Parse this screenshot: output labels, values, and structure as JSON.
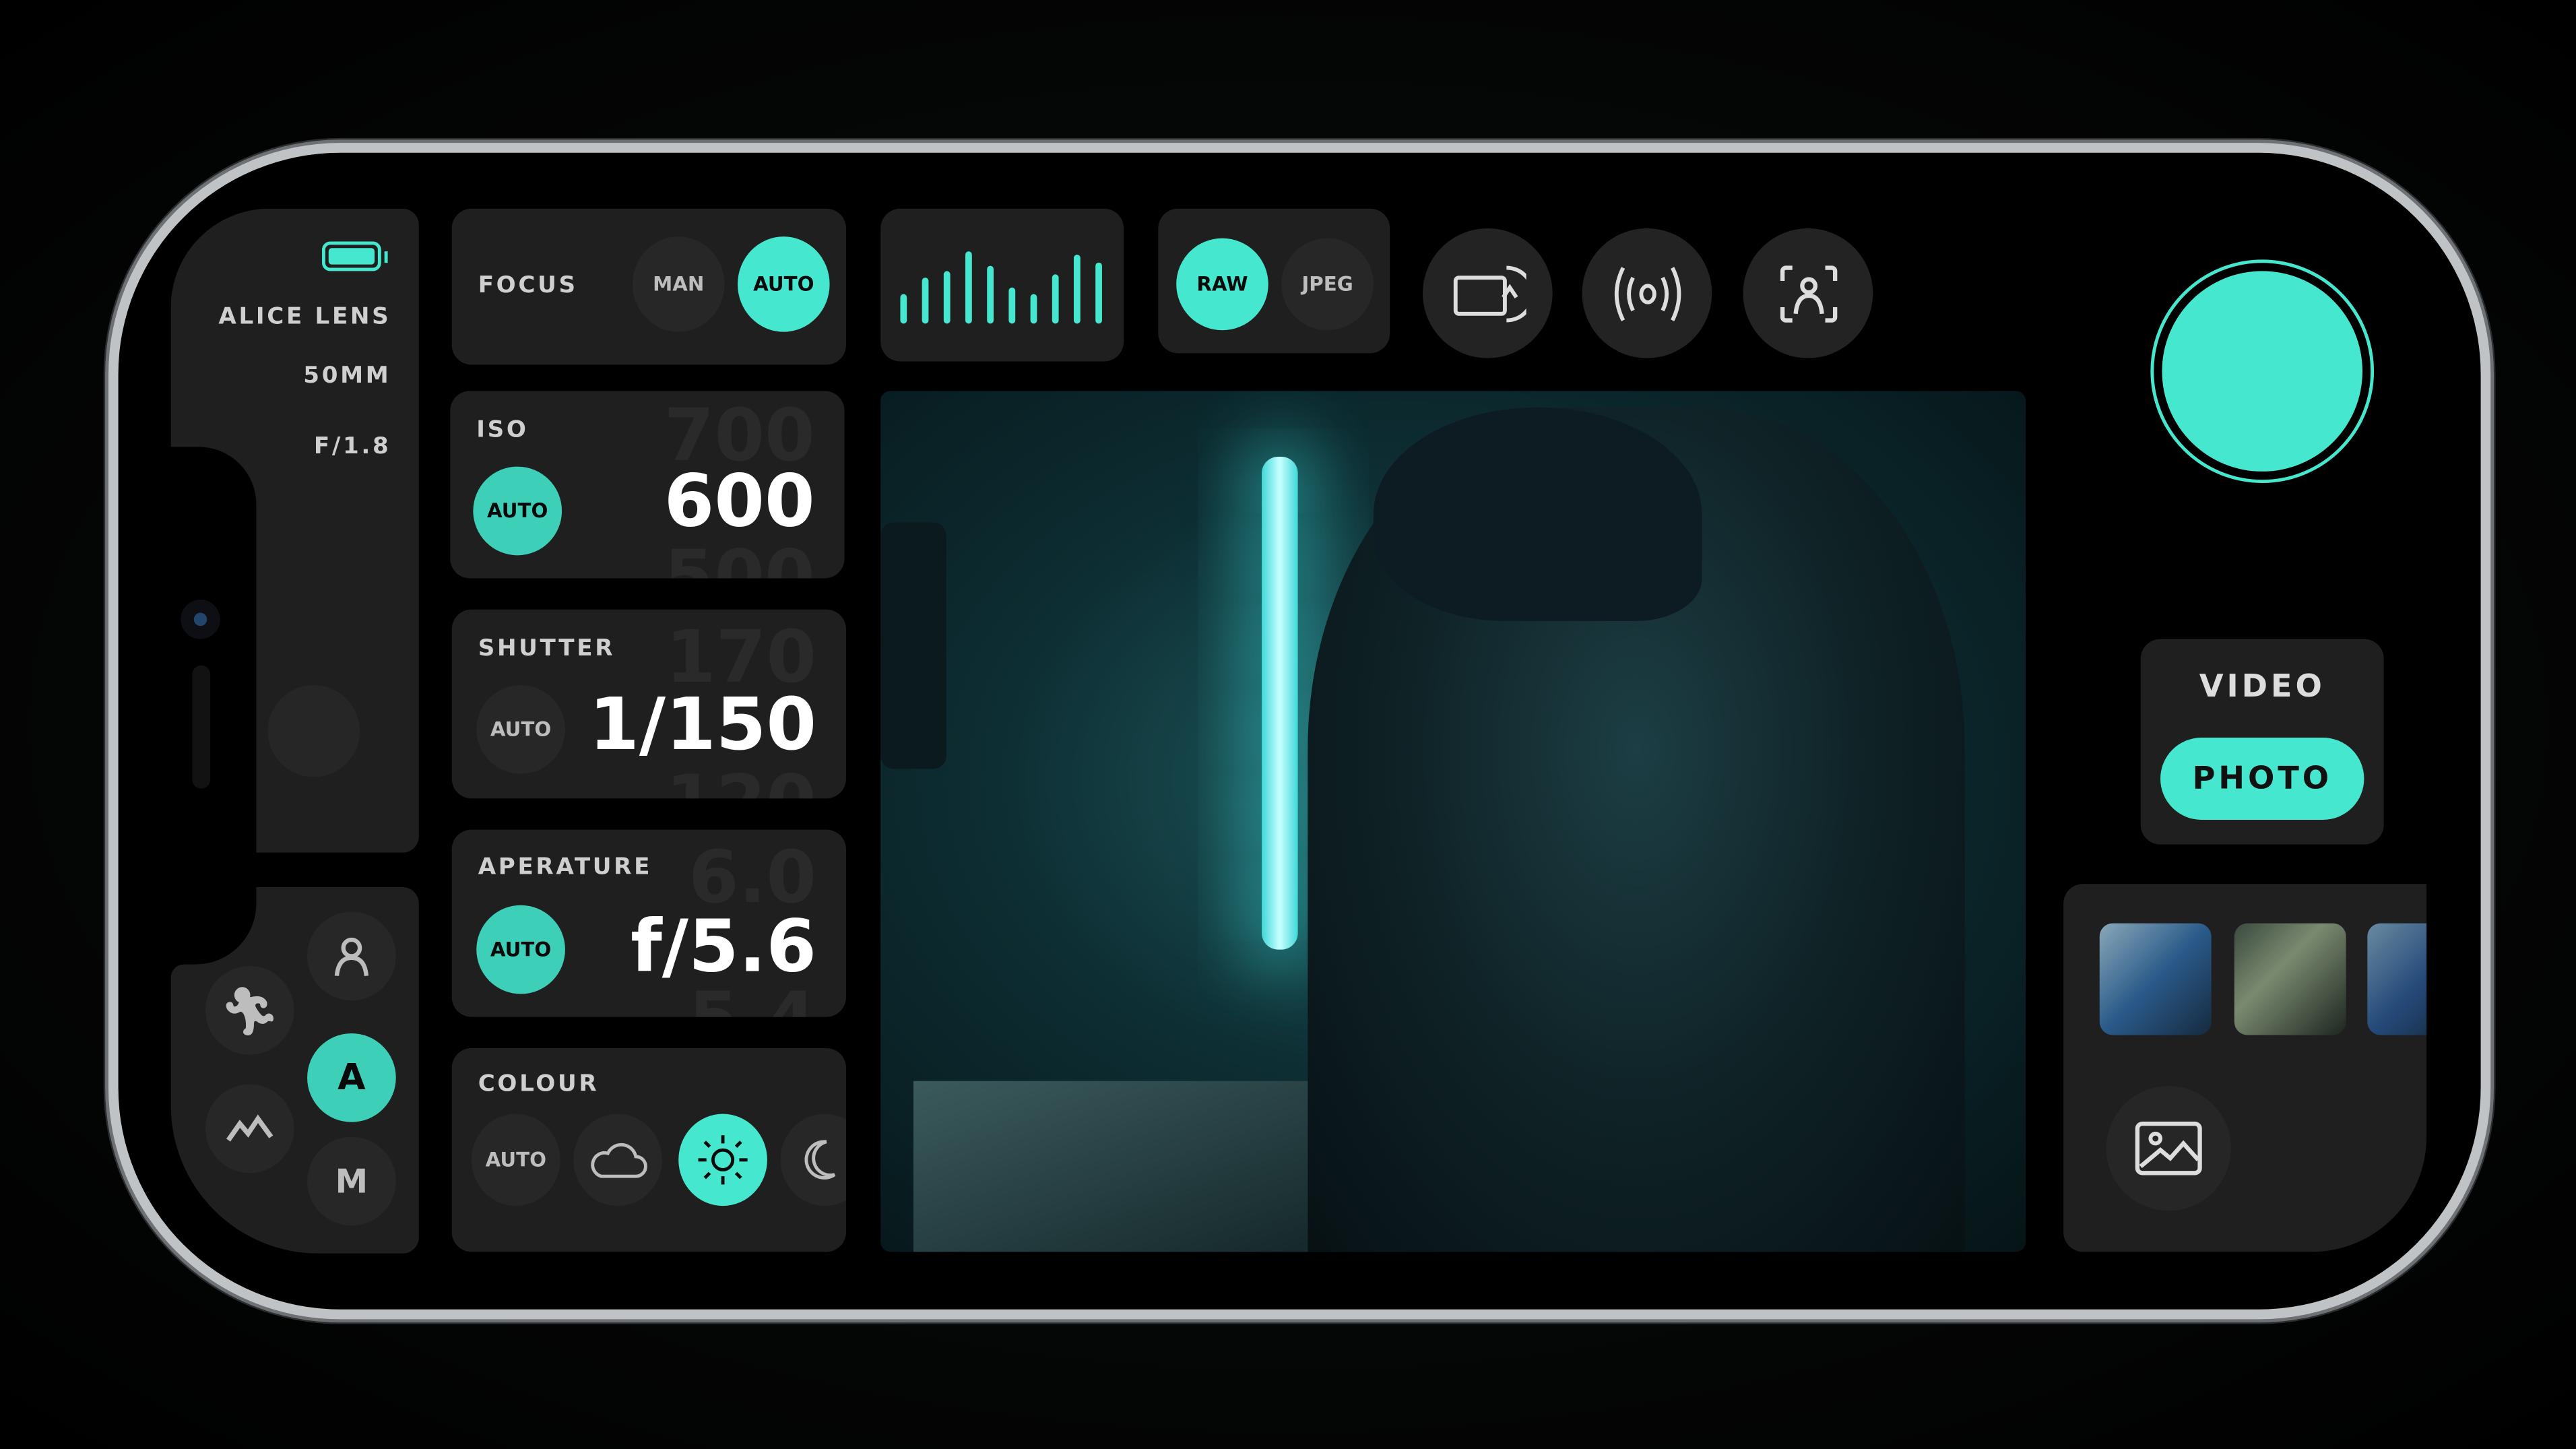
{
  "accent_color": "#45e8cf",
  "lens": {
    "battery_icon": "battery-full-icon",
    "name": "ALICE LENS",
    "focal_length": "50MM",
    "aperture": "F/1.8"
  },
  "modes": {
    "items": [
      {
        "icon": "portrait-icon"
      },
      {
        "icon": "running-person-icon"
      },
      {
        "label": "A",
        "selected": true
      },
      {
        "icon": "landscape-icon"
      },
      {
        "label": "M"
      }
    ]
  },
  "focus": {
    "title": "FOCUS",
    "options": [
      "MAN",
      "AUTO"
    ],
    "selected": "AUTO"
  },
  "iso": {
    "title": "ISO",
    "auto_label": "AUTO",
    "auto_on": true,
    "value": "600",
    "prev": "700",
    "next": "500"
  },
  "shutter": {
    "title": "SHUTTER",
    "auto_label": "AUTO",
    "auto_on": false,
    "value": "1/150",
    "prev": "170",
    "next": "120"
  },
  "aperture": {
    "title": "APERATURE",
    "auto_label": "AUTO",
    "auto_on": true,
    "value": "f/5.6",
    "prev": "6.0",
    "next": "5.4"
  },
  "colour": {
    "title": "COLOUR",
    "options": [
      {
        "label": "AUTO"
      },
      {
        "icon": "cloud-icon"
      },
      {
        "icon": "sun-icon",
        "selected": true
      },
      {
        "icon": "moon-icon"
      }
    ]
  },
  "histogram": {
    "levels": [
      0.35,
      0.6,
      0.7,
      1.0,
      0.78,
      0.45,
      0.35,
      0.65,
      0.95,
      0.83
    ]
  },
  "format": {
    "options": [
      "RAW",
      "JPEG"
    ],
    "selected": "RAW"
  },
  "toolbar": {
    "icons": [
      "rotate-screen-icon",
      "broadcast-icon",
      "face-detect-icon"
    ]
  },
  "capture_mode": {
    "options": [
      "VIDEO",
      "PHOTO"
    ],
    "selected": "PHOTO"
  },
  "gallery": {
    "icon": "gallery-icon"
  }
}
